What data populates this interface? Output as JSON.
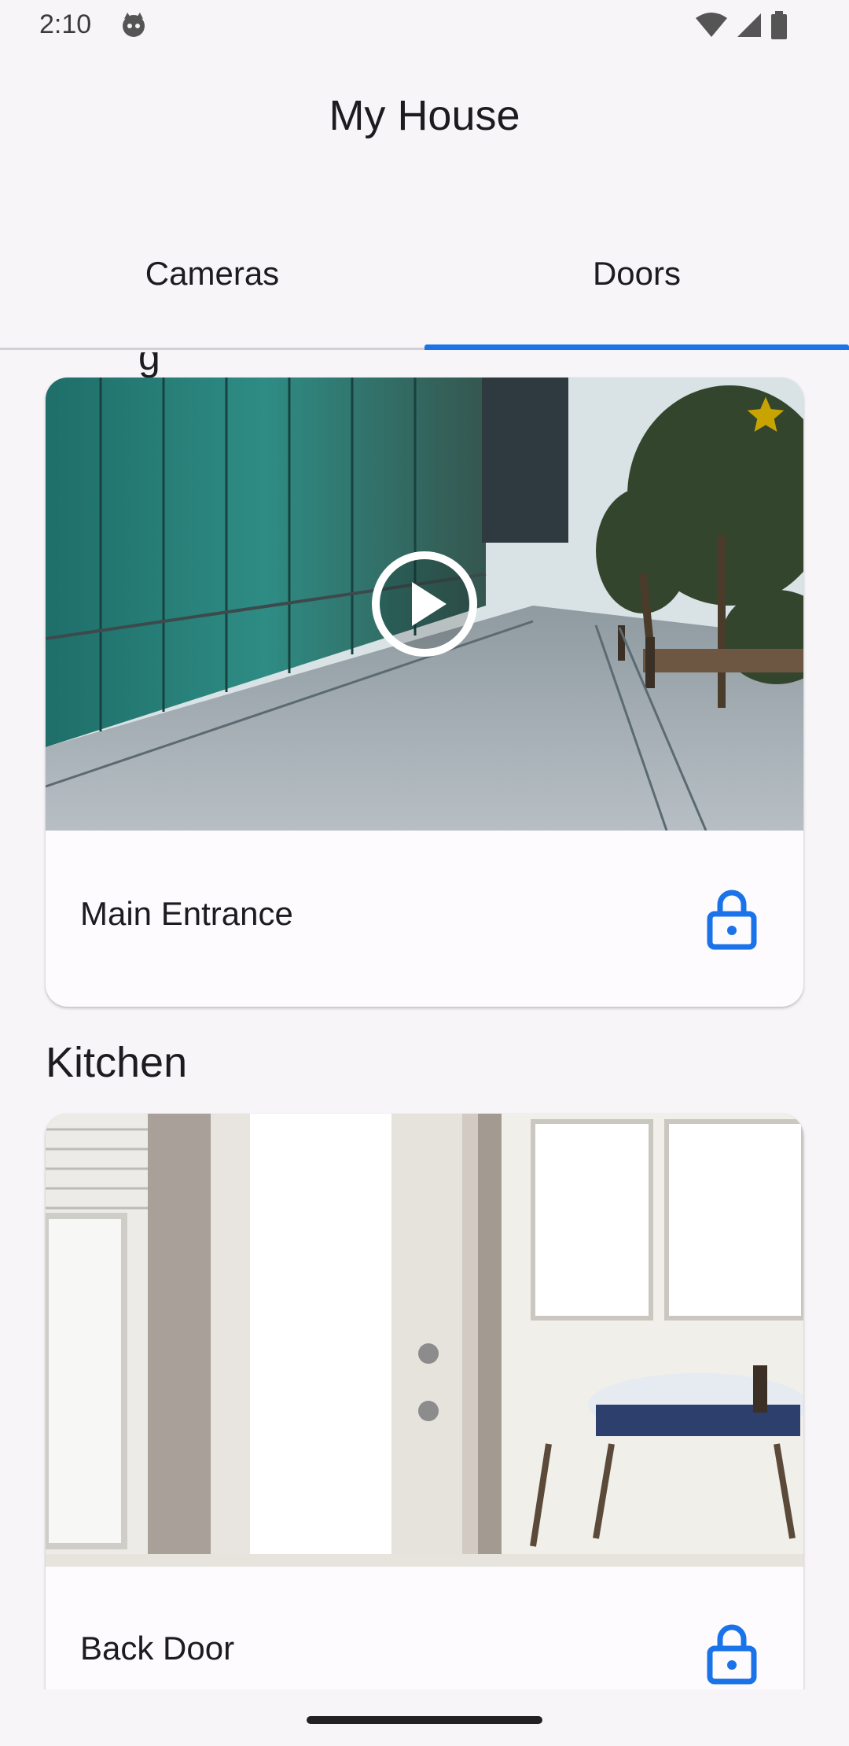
{
  "status_bar": {
    "time": "2:10",
    "icons": [
      "cat-icon",
      "wifi-icon",
      "signal-icon",
      "battery-icon"
    ]
  },
  "header": {
    "title": "My House"
  },
  "tabs": [
    {
      "label": "Cameras",
      "selected": false
    },
    {
      "label": "Doors",
      "selected": true
    }
  ],
  "colors": {
    "accent": "#1a73e8",
    "favorite": "#c9a300",
    "background": "#f8f5f9"
  },
  "content": {
    "peek_heading": "g",
    "sections": [
      {
        "heading": "",
        "cards": [
          {
            "name": "Main Entrance",
            "favorite": true,
            "icons": [
              "play-icon",
              "star-icon",
              "lock-icon"
            ]
          }
        ]
      },
      {
        "heading": "Kitchen",
        "cards": [
          {
            "name": "Back Door",
            "favorite": false,
            "icons": [
              "lock-icon"
            ]
          }
        ]
      }
    ]
  }
}
